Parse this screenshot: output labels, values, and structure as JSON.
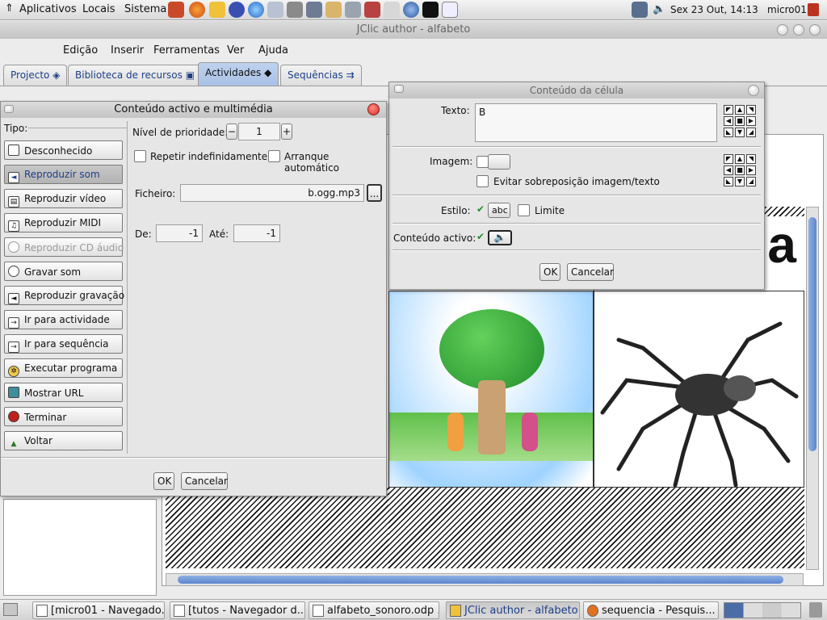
{
  "top_panel": {
    "menus": [
      "Aplicativos",
      "Locais",
      "Sistema"
    ],
    "clock": "Sex 23 Out, 14:13",
    "user": "micro01"
  },
  "window": {
    "title": "JClic author - alfabeto",
    "menubar": [
      "Edição",
      "Inserir",
      "Ferramentas",
      "Ver",
      "Ajuda"
    ],
    "tabs": [
      "Projecto",
      "Biblioteca de recursos",
      "Actividades",
      "Sequências"
    ],
    "active_tab": "Actividades"
  },
  "active_content_dialog": {
    "title": "Conteúdo activo e multimédia",
    "tipo_label": "Tipo:",
    "types": [
      {
        "label": "Desconhecido",
        "icon": "document-icon",
        "state": "normal"
      },
      {
        "label": "Reproduzir som",
        "icon": "speaker-icon",
        "state": "selected"
      },
      {
        "label": "Reproduzir vídeo",
        "icon": "film-icon",
        "state": "normal"
      },
      {
        "label": "Reproduzir MIDI",
        "icon": "music-note-icon",
        "state": "normal"
      },
      {
        "label": "Reproduzir CD áudio",
        "icon": "cd-icon",
        "state": "disabled"
      },
      {
        "label": "Gravar som",
        "icon": "speech-bubble-icon",
        "state": "normal"
      },
      {
        "label": "Reproduzir gravação",
        "icon": "speaker-record-icon",
        "state": "normal"
      },
      {
        "label": "Ir para actividade",
        "icon": "goto-activity-icon",
        "state": "normal"
      },
      {
        "label": "Ir para sequência",
        "icon": "goto-sequence-icon",
        "state": "normal"
      },
      {
        "label": "Executar programa",
        "icon": "gear-icon",
        "state": "normal"
      },
      {
        "label": "Mostrar URL",
        "icon": "globe-icon",
        "state": "normal"
      },
      {
        "label": "Terminar",
        "icon": "stop-icon",
        "state": "normal"
      },
      {
        "label": "Voltar",
        "icon": "back-triangle-icon",
        "state": "normal"
      }
    ],
    "priority_label": "Nível de prioridade:",
    "priority_value": "1",
    "repeat_label": "Repetir indefinidamente",
    "autostart_label": "Arranque automático",
    "file_label": "Ficheiro:",
    "file_value": "b.ogg.mp3",
    "browse_label": "...",
    "from_label": "De:",
    "from_value": "-1",
    "to_label": "Até:",
    "to_value": "-1",
    "ok": "OK",
    "cancel": "Cancelar"
  },
  "cell_dialog": {
    "title": "Conteúdo da célula",
    "text_label": "Texto:",
    "text_value": "B",
    "image_label": "Imagem:",
    "avoid_overlap_label": "Evitar sobreposição imagem/texto",
    "style_label": "Estilo:",
    "style_sample": "abc",
    "limit_label": "Limite",
    "active_content_label": "Conteúdo activo:",
    "ok": "OK",
    "cancel": "Cancelar"
  },
  "preview": {
    "big_letter": "a"
  },
  "taskbar": {
    "tasks": [
      {
        "label": "[micro01 - Navegado...",
        "active": false
      },
      {
        "label": "[tutos - Navegador d...",
        "active": false
      },
      {
        "label": "alfabeto_sonoro.odp ...",
        "active": false
      },
      {
        "label": "JClic author - alfabeto",
        "active": true
      },
      {
        "label": "sequencia - Pesquis...",
        "active": false
      }
    ]
  },
  "colors": {
    "selected_tab": "#a9c1e6",
    "link_text": "#1d3f86",
    "close_button": "#d9302a"
  }
}
